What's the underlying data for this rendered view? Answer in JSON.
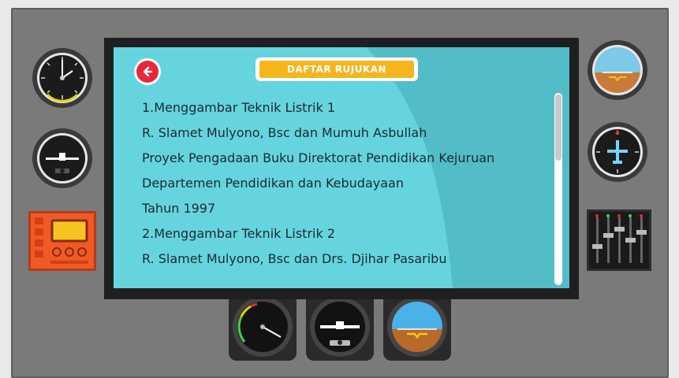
{
  "header": {
    "back_label": "←",
    "title": "DAFTAR RUJUKAN"
  },
  "references": [
    "1.Menggambar Teknik Listrik 1",
    "R. Slamet Mulyono, Bsc dan Mumuh Asbullah",
    "Proyek Pengadaan Buku Direktorat Pendidikan Kejuruan",
    "Departemen Pendidikan dan Kebudayaan",
    "Tahun 1997",
    "2.Menggambar Teknik Listrik 2",
    "R. Slamet Mulyono, Bsc dan Drs. Djihar Pasaribu"
  ],
  "gauges": {
    "left": [
      "altimeter-icon",
      "turn-coordinator-icon",
      "radio-panel-icon"
    ],
    "right": [
      "attitude-indicator-icon",
      "heading-indicator-icon",
      "throttle-levers-icon"
    ],
    "bottom": [
      "airspeed-indicator-icon",
      "turn-indicator-icon",
      "attitude-indicator-icon"
    ]
  },
  "colors": {
    "accent": "#f5b51c",
    "back": "#e8283a",
    "screen": "#66d4de",
    "frame": "#7a7a7a"
  }
}
